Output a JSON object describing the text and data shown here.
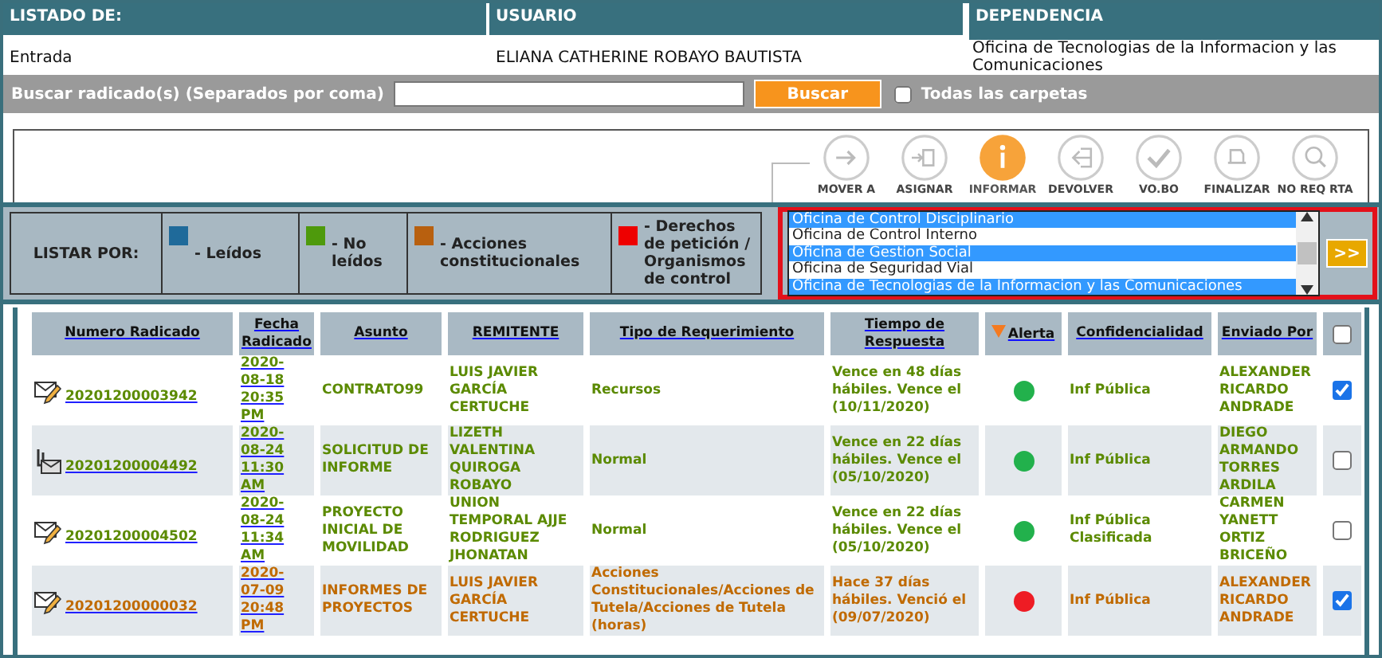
{
  "header": {
    "columns": [
      {
        "label": "LISTADO DE:",
        "value": "Entrada"
      },
      {
        "label": "USUARIO",
        "value": "ELIANA CATHERINE ROBAYO BAUTISTA"
      },
      {
        "label": "DEPENDENCIA",
        "value": "Oficina de Tecnologias de la Informacion y las Comunicaciones"
      }
    ]
  },
  "search": {
    "label": "Buscar radicado(s) (Separados por coma)",
    "button": "Buscar",
    "all_folders": {
      "label": "Todas las carpetas",
      "checked": false
    }
  },
  "actions": [
    {
      "label": "MOVER A",
      "kind": "move",
      "selected": false
    },
    {
      "label": "ASIGNAR",
      "kind": "assign",
      "selected": false
    },
    {
      "label": "INFORMAR",
      "kind": "info",
      "selected": true
    },
    {
      "label": "DEVOLVER",
      "kind": "return",
      "selected": false
    },
    {
      "label": "VO.BO",
      "kind": "check",
      "selected": false
    },
    {
      "label": "FINALIZAR",
      "kind": "finish",
      "selected": false
    },
    {
      "label": "NO REQ RTA",
      "kind": "noreply",
      "selected": false
    }
  ],
  "filter": {
    "label": "LISTAR POR:",
    "legend": [
      {
        "label": "- Leídos",
        "color": "#1f6a9a"
      },
      {
        "label": "- No leídos",
        "color": "#4e9a0c"
      },
      {
        "label": "- Acciones constitucionales",
        "color": "#b8600f"
      },
      {
        "label": "- Derechos de petición / Organismos de control",
        "color": "#ee0000"
      }
    ],
    "offices": [
      {
        "label": "Oficina de Control Disciplinario",
        "selected": true
      },
      {
        "label": "Oficina de Control Interno",
        "selected": false
      },
      {
        "label": "Oficina de Gestion Social",
        "selected": true
      },
      {
        "label": "Oficina de Seguridad Vial",
        "selected": false
      },
      {
        "label": "Oficina de Tecnologias de la Informacion y las Comunicaciones",
        "selected": true
      }
    ],
    "go_button": ">>"
  },
  "table": {
    "columns": [
      "Numero Radicado",
      "Fecha Radicado",
      "Asunto",
      "REMITENTE",
      "Tipo de Requerimiento",
      "Tiempo de Respuesta",
      "Alerta",
      "Confidencialidad",
      "Enviado Por"
    ],
    "select_all": {
      "checked": false
    },
    "rows": [
      {
        "kind": "mail",
        "color": "#5b8a00",
        "number": "20201200003942",
        "date": "2020-08-18 20:35 PM",
        "subject": "CONTRATO99",
        "sender": "LUIS JAVIER GARCÍA CERTUCHE",
        "type": "Recursos",
        "response": "Vence en 48 días hábiles. Vence el (10/11/2020)",
        "alert": {
          "color": "#22b14c"
        },
        "confidentiality": "Inf Pública",
        "sent_by": "ALEXANDER RICARDO ANDRADE",
        "checked": true
      },
      {
        "kind": "attachment",
        "color": "#5b8a00",
        "number": "20201200004492",
        "date": "2020-08-24 11:30 AM",
        "subject": "SOLICITUD DE INFORME",
        "sender": "LIZETH VALENTINA QUIROGA ROBAYO",
        "type": "Normal",
        "response": "Vence en 22 días hábiles. Vence el (05/10/2020)",
        "alert": {
          "color": "#22b14c"
        },
        "confidentiality": "Inf Pública",
        "sent_by": "DIEGO ARMANDO TORRES ARDILA",
        "checked": false
      },
      {
        "kind": "mail",
        "color": "#5b8a00",
        "number": "20201200004502",
        "date": "2020-08-24 11:34 AM",
        "subject": "PROYECTO INICIAL DE MOVILIDAD",
        "sender": "UNION TEMPORAL AJJE RODRIGUEZ JHONATAN",
        "type": "Normal",
        "response": "Vence en 22 días hábiles. Vence el (05/10/2020)",
        "alert": {
          "color": "#22b14c"
        },
        "confidentiality": "Inf Pública Clasificada",
        "sent_by": "CARMEN YANETT ORTIZ BRICEÑO",
        "checked": false
      },
      {
        "kind": "mail",
        "color": "#c06a00",
        "number": "20201200000032",
        "date": "2020-07-09 20:48 PM",
        "subject": "INFORMES DE PROYECTOS",
        "sender": "LUIS JAVIER GARCÍA CERTUCHE",
        "type": "Acciones Constitucionales/Acciones de Tutela/Acciones de Tutela (horas)",
        "response": "Hace 37 días hábiles. Venció el (09/07/2020)",
        "alert": {
          "color": "#ee1c24"
        },
        "confidentiality": "Inf Pública",
        "sent_by": "ALEXANDER RICARDO ANDRADE",
        "checked": true
      }
    ]
  }
}
